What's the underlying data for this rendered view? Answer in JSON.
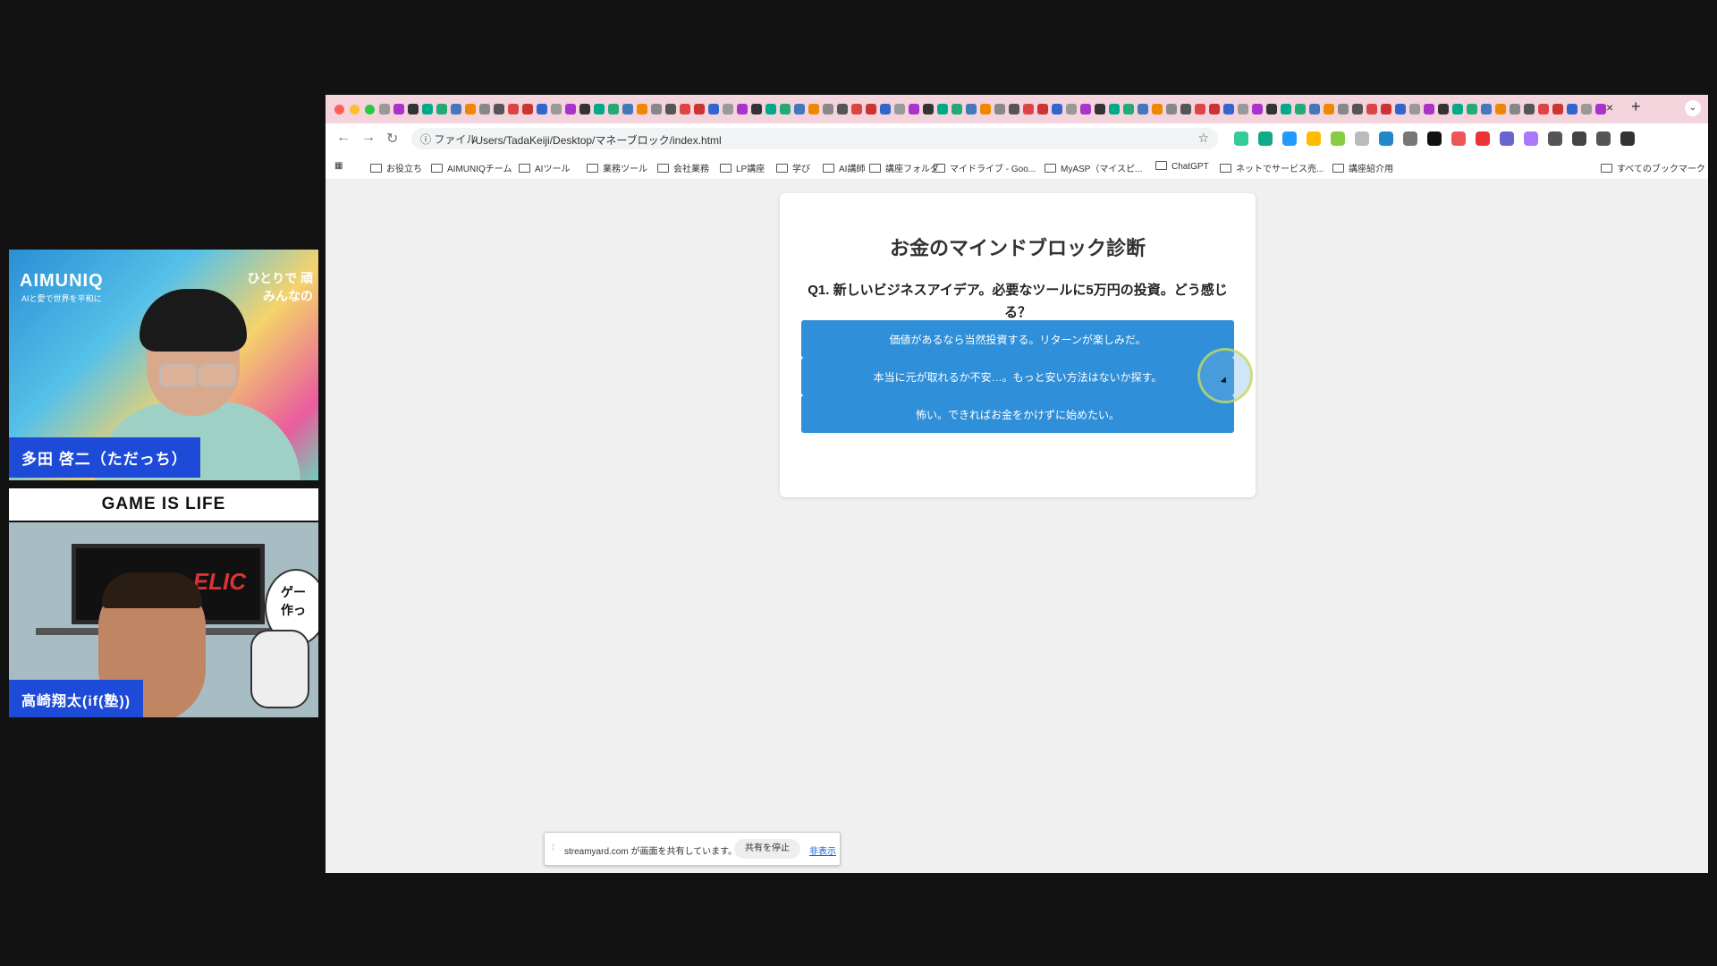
{
  "participants": [
    {
      "name": "多田 啓二（ただっち）",
      "brand": "AIMUNIQ",
      "brand_sub": "AIと愛で世界を平和に",
      "slogan_line1": "ひとりで 頑",
      "slogan_line2": "みんなの"
    },
    {
      "name": "高崎翔太(if(塾))",
      "monitor_text": "ELIC",
      "bubble_line1": "ゲー",
      "bubble_line2": "作っ"
    }
  ],
  "banner": "GAME IS LIFE",
  "browser": {
    "tab_close": "×",
    "tab_new": "+",
    "address_prefix": "ファイル",
    "url": "/Users/TadaKeiji/Desktop/マネーブロック/index.html",
    "bookmarks": [
      "お役立ち",
      "AIMUNIQチーム",
      "AIツール",
      "業務ツール",
      "会社業務",
      "LP講座",
      "学び",
      "AI講師",
      "講座フォルダ",
      "マイドライブ - Goo...",
      "MyASP（マイスピ...",
      "ChatGPT",
      "ネットでサービス売...",
      "講座紹介用",
      "すべてのブックマーク"
    ]
  },
  "quiz": {
    "title": "お金のマインドブロック診断",
    "question_line1": "Q1. 新しいビジネスアイデア。必要なツールに5万円の投資。どう感じ",
    "question_line2": "る？",
    "options": [
      "価値があるなら当然投資する。リターンが楽しみだ。",
      "本当に元が取れるか不安…。もっと安い方法はないか探す。",
      "怖い。できればお金をかけずに始めたい。"
    ]
  },
  "share_bar": {
    "message": "streamyard.com が画面を共有しています。",
    "stop_label": "共有を停止",
    "hide_label": "非表示"
  },
  "colors": {
    "button_blue": "#2f8fd8",
    "name_tag_blue": "#1d4ad6",
    "tab_bar_pink": "#f3d3dc"
  }
}
